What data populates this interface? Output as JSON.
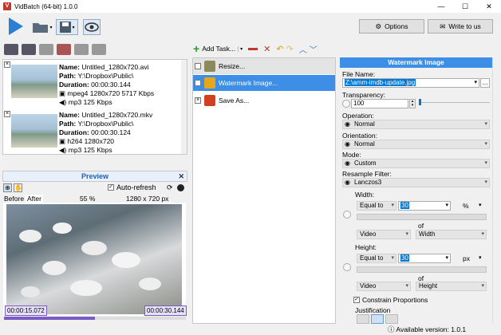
{
  "window": {
    "title": "VidBatch (64-bit) 1.0.0",
    "minimize": "—",
    "maximize": "☐",
    "close": "✕"
  },
  "toolbar": {
    "options_label": "Options",
    "write_label": "Write to us"
  },
  "files": [
    {
      "name_label": "Name:",
      "name": "Untitled_1280x720.avi",
      "path_label": "Path:",
      "path": "Y:\\Dropbox\\Public\\",
      "duration_label": "Duration:",
      "duration": "00:00:30.144",
      "video": "mpeg4 1280x720 5717 Kbps",
      "audio": "mp3 125 Kbps"
    },
    {
      "name_label": "Name:",
      "name": "Untitled_1280x720.mkv",
      "path_label": "Path:",
      "path": "Y:\\Dropbox\\Public\\",
      "duration_label": "Duration:",
      "duration": "00:00:30.124",
      "video": "h264 1280x720",
      "audio": "mp3 125 Kbps"
    }
  ],
  "preview": {
    "title": "Preview",
    "auto_refresh": "Auto-refresh",
    "before": "Before",
    "after": "After",
    "zoom": "55 %",
    "resolution": "1280 x 720 px",
    "time_start": "00:00:15.072",
    "time_end": "00:00:30.144",
    "position_fraction": 0.5
  },
  "tasks": {
    "add_label": "Add Task...",
    "items": [
      "Resize...",
      "Watermark Image...",
      "Save As..."
    ]
  },
  "watermark": {
    "title": "Watermark Image",
    "file_name_label": "File Name:",
    "file_name": "Z:\\amm-imdb-update.jpg",
    "browse": "...",
    "transparency_label": "Transparency:",
    "transparency": "100",
    "operation_label": "Operation:",
    "operation": "Normal",
    "orientation_label": "Orientation:",
    "orientation": "Normal",
    "mode_label": "Mode:",
    "mode": "Custom",
    "resample_label": "Resample Filter:",
    "resample": "Lanczos3",
    "width_label": "Width:",
    "width_mode": "Equal to",
    "width_value": "30",
    "width_unit": "%",
    "width_of": "of",
    "width_ref1": "Video",
    "width_ref2": "Width",
    "height_label": "Height:",
    "height_mode": "Equal to",
    "height_value": "30",
    "height_unit": "px",
    "height_of": "of",
    "height_ref1": "Video",
    "height_ref2": "Height",
    "constrain_label": "Constrain Proportions",
    "justification_label": "Justification"
  },
  "status": {
    "available": "Available version: 1.0.1"
  },
  "colors": {
    "accent": "#3d8ee6",
    "seek": "#7b5cc4",
    "play": "#2a7fd4"
  }
}
